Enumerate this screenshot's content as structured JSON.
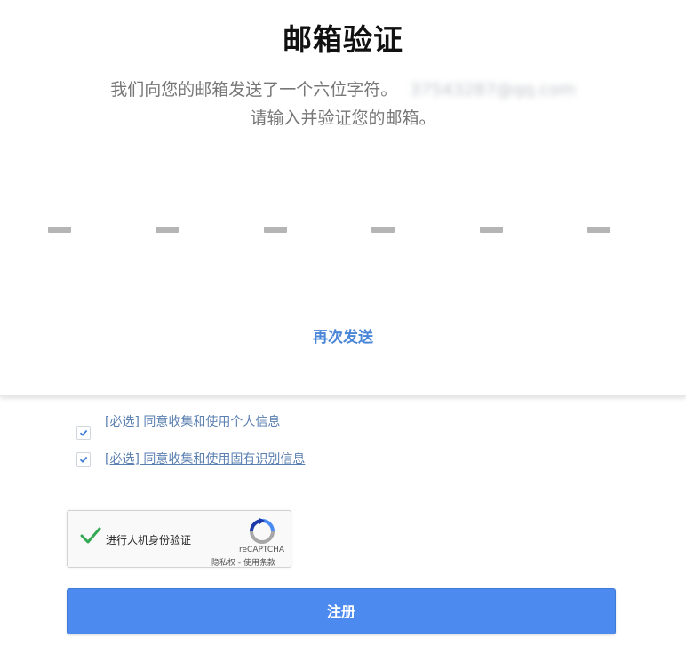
{
  "page": {
    "title": "邮箱验证",
    "description_line1": "我们向您的邮箱发送了一个六位字符。",
    "email_masked": "37543287@qq.com",
    "description_line2": "请输入并验证您的邮箱。"
  },
  "code_inputs": [
    {
      "value": "",
      "placeholder": "—"
    },
    {
      "value": "",
      "placeholder": "—"
    },
    {
      "value": "",
      "placeholder": "—"
    },
    {
      "value": "",
      "placeholder": "—"
    },
    {
      "value": "",
      "placeholder": "—"
    },
    {
      "value": "",
      "placeholder": "—"
    }
  ],
  "resend_label": "再次发送",
  "agreements": [
    {
      "label": "[必选] 同意收集和使用个人信息",
      "checked": true
    },
    {
      "label": "[必选] 同意收集和使用固有识别信息",
      "checked": true
    }
  ],
  "recaptcha": {
    "label": "进行人机身份验证",
    "brand": "reCAPTCHA",
    "terms": "隐私权 - 使用条款",
    "checked": true
  },
  "register_button": {
    "label": "注册"
  },
  "colors": {
    "accent": "#4d8af0",
    "link": "#5a7fb0",
    "resend": "#4a86d8",
    "check_green": "#35a853"
  }
}
